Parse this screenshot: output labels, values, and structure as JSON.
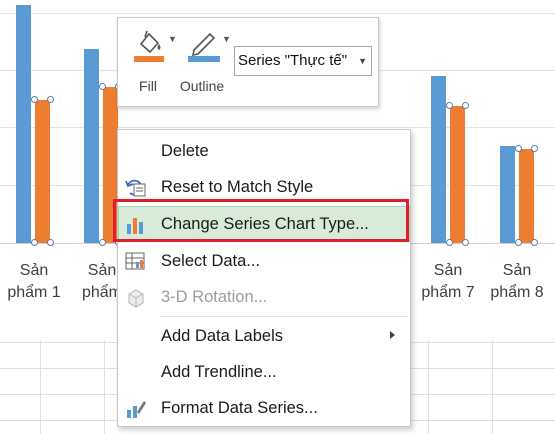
{
  "chart": {
    "x_labels": [
      "Sản\nphẩm 1",
      "Sản\nphẩm",
      "Sản\nphẩm 7",
      "Sản\nphẩm 8"
    ]
  },
  "chart_data": {
    "type": "bar",
    "categories": [
      "Sản phẩm 1",
      "Sản phẩm",
      "Sản phẩm 7",
      "Sản phẩm 8"
    ],
    "series": [
      {
        "name": "",
        "values": [
          245,
          200,
          172,
          100
        ]
      },
      {
        "name": "Thực tế",
        "values": [
          147,
          160,
          141,
          97
        ]
      }
    ],
    "colors": [
      "#5b9bd5",
      "#ed7d31"
    ],
    "ylim": [
      0,
      250
    ],
    "grid": true
  },
  "minibar": {
    "fill_label": "Fill",
    "outline_label": "Outline",
    "series_value": "Series \"Thực tế\"",
    "fill_color": "#ed7d31",
    "outline_color": "#5b9bd5"
  },
  "menu": {
    "items": [
      {
        "label": "Delete",
        "icon": "none",
        "enabled": true
      },
      {
        "label": "Reset to Match Style",
        "icon": "reset-style-icon",
        "enabled": true
      },
      {
        "label": "Change Series Chart Type...",
        "icon": "chart-type-icon",
        "enabled": true,
        "highlighted": true
      },
      {
        "label": "Select Data...",
        "icon": "select-data-icon",
        "enabled": true
      },
      {
        "label": "3-D Rotation...",
        "icon": "rotation-3d-icon",
        "enabled": false
      },
      {
        "label": "Add Data Labels",
        "icon": "none",
        "enabled": true,
        "submenu": true
      },
      {
        "label": "Add Trendline...",
        "icon": "none",
        "enabled": true
      },
      {
        "label": "Format Data Series...",
        "icon": "format-series-icon",
        "enabled": true
      }
    ],
    "highlight_color": "#d7ebd8",
    "callout_color": "#e21c2a"
  }
}
